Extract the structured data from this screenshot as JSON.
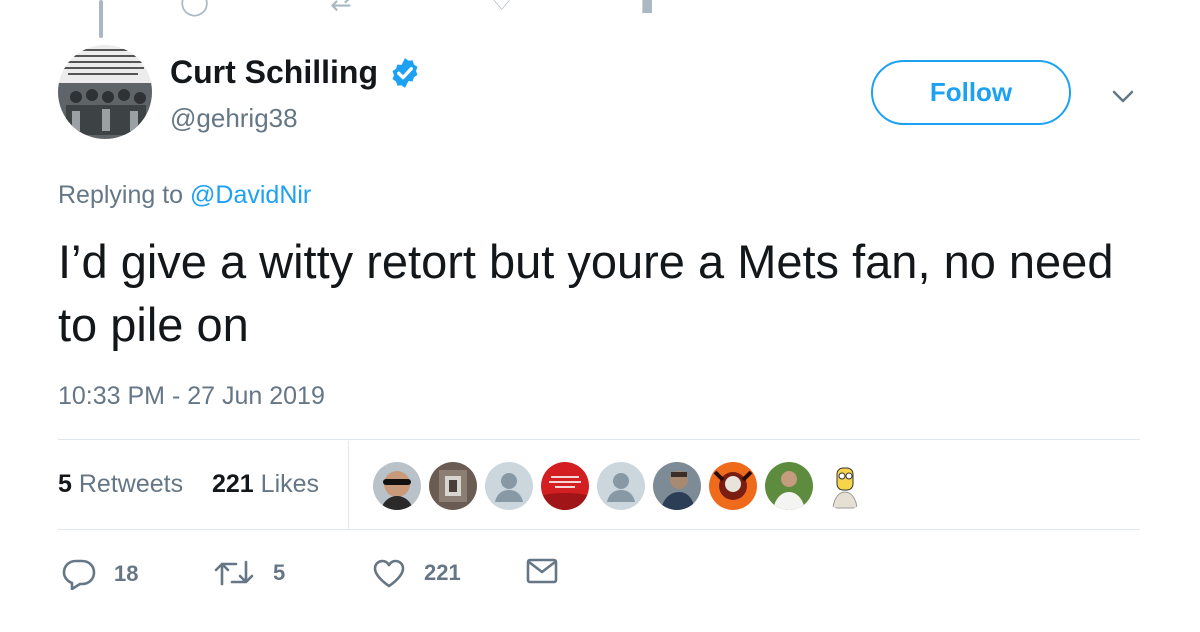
{
  "author": {
    "name": "Curt Schilling",
    "handle": "@gehrig38",
    "verified": true,
    "verified_color": "#1da1f2"
  },
  "follow_button": {
    "label": "Follow"
  },
  "reply": {
    "prefix": "Replying to ",
    "mention": "@DavidNir"
  },
  "tweet": {
    "text": "I’d give a witty retort but youre a Mets fan, no need to pile on",
    "timestamp": "10:33 PM - 27 Jun 2019"
  },
  "stats": {
    "retweets_count": "5",
    "retweets_label": "Retweets",
    "likes_count": "221",
    "likes_label": "Likes"
  },
  "liked_by_avatars": [
    "avatar-1",
    "avatar-2",
    "avatar-default",
    "avatar-red-hat",
    "avatar-default",
    "avatar-5",
    "avatar-6",
    "avatar-7",
    "avatar-cartoon"
  ],
  "actions": {
    "reply_count": "18",
    "retweet_count": "5",
    "like_count": "221"
  },
  "colors": {
    "accent": "#1da1f2",
    "secondary_text": "#657786",
    "primary_text": "#14171a",
    "divider": "#e1e8ed"
  }
}
